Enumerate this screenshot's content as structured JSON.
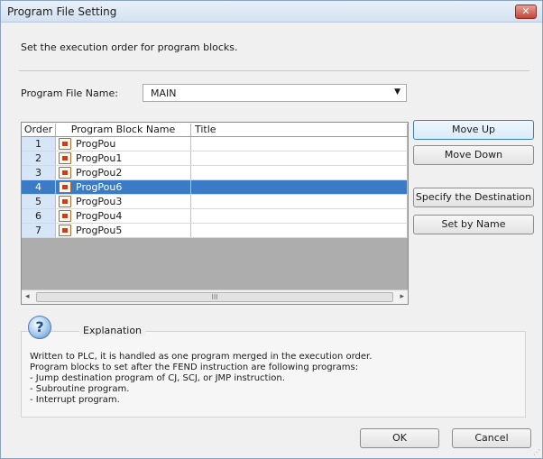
{
  "window": {
    "title": "Program File Setting",
    "close_glyph": "✕"
  },
  "instruction": "Set the execution order for program blocks.",
  "program_file": {
    "label": "Program File Name:",
    "value": "MAIN"
  },
  "table": {
    "columns": [
      "Order",
      "Program Block Name",
      "Title"
    ],
    "rows": [
      {
        "order": "1",
        "name": "ProgPou",
        "title": ""
      },
      {
        "order": "2",
        "name": "ProgPou1",
        "title": ""
      },
      {
        "order": "3",
        "name": "ProgPou2",
        "title": ""
      },
      {
        "order": "4",
        "name": "ProgPou6",
        "title": ""
      },
      {
        "order": "5",
        "name": "ProgPou3",
        "title": ""
      },
      {
        "order": "6",
        "name": "ProgPou4",
        "title": ""
      },
      {
        "order": "7",
        "name": "ProgPou5",
        "title": ""
      }
    ],
    "selected_index": 3,
    "scroll_left": "◂",
    "scroll_right": "▸",
    "scroll_thumb": "III"
  },
  "buttons": {
    "move_up": "Move Up",
    "move_down": "Move Down",
    "specify_destination": "Specify the Destination",
    "set_by_name": "Set by Name",
    "ok": "OK",
    "cancel": "Cancel"
  },
  "explanation": {
    "title": "Explanation",
    "icon_glyph": "?",
    "lines": [
      "Written to PLC, it is handled as one program merged in the execution order.",
      "Program blocks to set after the FEND instruction are following programs:",
      "- Jump destination program of CJ, SCJ, or JMP instruction.",
      "- Subroutine program.",
      "- Interrupt program."
    ]
  },
  "icons": {
    "close": "close-icon",
    "dropdown": "chevron-down-icon",
    "block": "program-block-icon",
    "help": "question-icon"
  },
  "colors": {
    "selection": "#3b7bc6",
    "order_column": "#d6e6f7",
    "close": "#c4453a"
  }
}
